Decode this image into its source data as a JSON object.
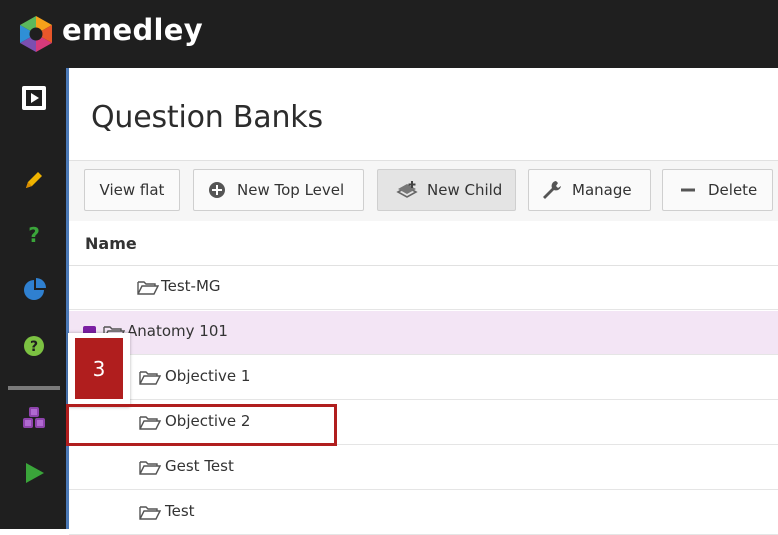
{
  "brand": {
    "name": "emedley"
  },
  "colors": {
    "topbar": "#1f1f1f",
    "accent": "#4b79b7",
    "selected_row": "#f3e5f5",
    "callout": "#b01e1e"
  },
  "sidebar": {
    "items": [
      {
        "icon": "play-box-icon"
      },
      {
        "icon": "pencil-icon"
      },
      {
        "icon": "question-mark-icon"
      },
      {
        "icon": "pie-chart-icon"
      },
      {
        "icon": "help-circle-icon"
      },
      {
        "icon": "cubes-icon"
      },
      {
        "icon": "play-triangle-icon"
      }
    ]
  },
  "page": {
    "title": "Question Banks"
  },
  "toolbar": {
    "view_flat": "View flat",
    "new_top_level": "New Top Level",
    "new_child": "New Child",
    "manage": "Manage",
    "delete": "Delete"
  },
  "grid": {
    "column_name": "Name",
    "rows": [
      {
        "label": "Test-MG"
      },
      {
        "label": "Anatomy 101",
        "selected": true
      },
      {
        "label": "Objective 1"
      },
      {
        "label": "Objective 2"
      },
      {
        "label": "Gest Test"
      },
      {
        "label": "Test"
      }
    ]
  },
  "callout": {
    "number": "3"
  }
}
